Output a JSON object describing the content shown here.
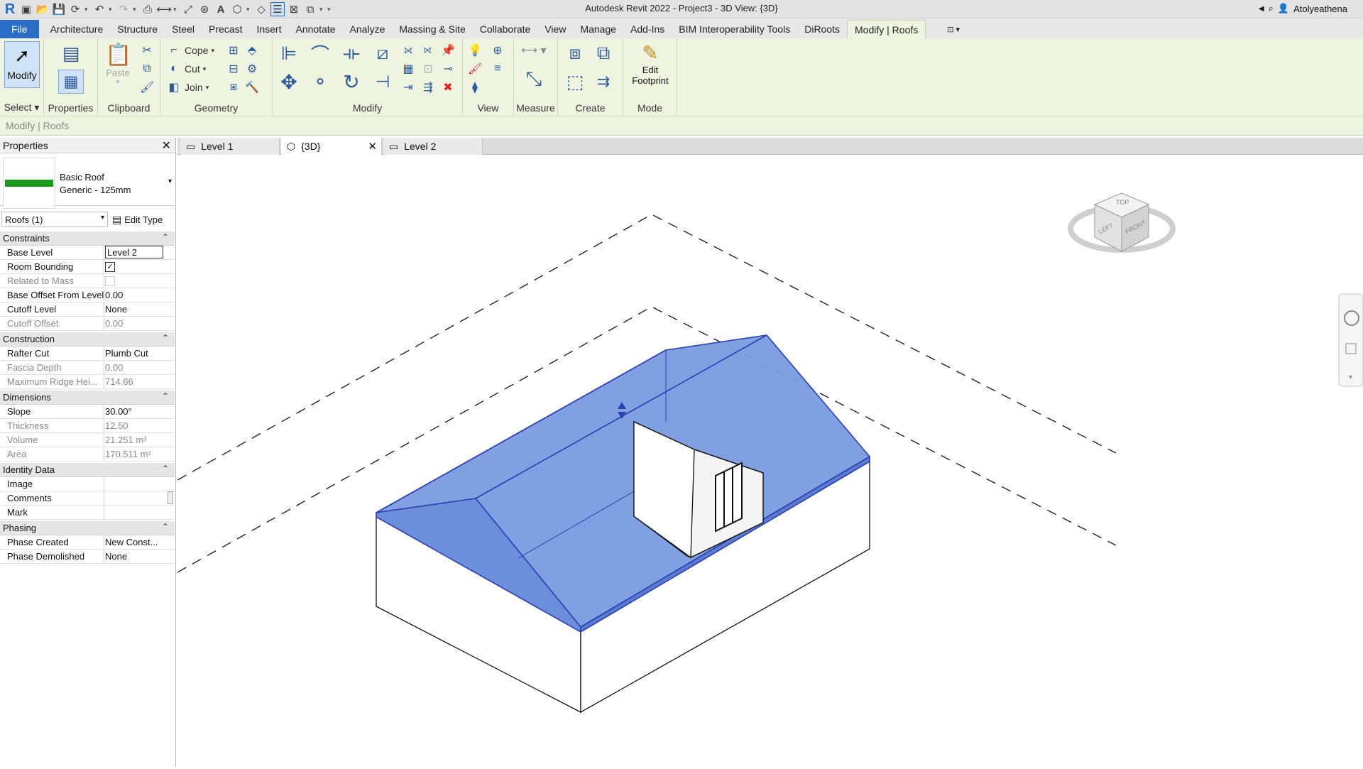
{
  "titlebar": {
    "title": "Autodesk Revit 2022 - Project3 - 3D View: {3D}",
    "user": "Atolyeathena"
  },
  "menu": {
    "tabs": [
      "File",
      "Architecture",
      "Structure",
      "Steel",
      "Precast",
      "Insert",
      "Annotate",
      "Analyze",
      "Massing & Site",
      "Collaborate",
      "View",
      "Manage",
      "Add-Ins",
      "BIM Interoperability Tools",
      "DiRoots",
      "Modify | Roofs"
    ],
    "active_tab": "Modify | Roofs"
  },
  "ribbon": {
    "modify_label": "Modify",
    "select_label": "Select",
    "properties_label": "Properties",
    "clipboard": {
      "paste": "Paste",
      "label": "Clipboard"
    },
    "geometry": {
      "cope": "Cope",
      "cut": "Cut",
      "join": "Join",
      "label": "Geometry"
    },
    "modify_panel_label": "Modify",
    "view_label": "View",
    "measure_label": "Measure",
    "create_label": "Create",
    "mode": {
      "edit_line1": "Edit",
      "edit_line2": "Footprint",
      "label": "Mode"
    }
  },
  "context_bar": {
    "text": "Modify | Roofs"
  },
  "properties": {
    "title": "Properties",
    "type_name": "Basic Roof",
    "type_sub": "Generic - 125mm",
    "filter": "Roofs (1)",
    "edit_type": "Edit Type",
    "groups": {
      "constraints": "Constraints",
      "construction": "Construction",
      "dimensions": "Dimensions",
      "identity": "Identity Data",
      "phasing": "Phasing"
    },
    "rows": {
      "base_level": {
        "k": "Base Level",
        "v": "Level 2"
      },
      "room_bounding": {
        "k": "Room Bounding",
        "checked": true
      },
      "related_mass": {
        "k": "Related to Mass"
      },
      "base_offset": {
        "k": "Base Offset From Level",
        "v": "0.00"
      },
      "cutoff_level": {
        "k": "Cutoff Level",
        "v": "None"
      },
      "cutoff_offset": {
        "k": "Cutoff Offset",
        "v": "0.00"
      },
      "rafter_cut": {
        "k": "Rafter Cut",
        "v": "Plumb Cut"
      },
      "fascia_depth": {
        "k": "Fascia Depth",
        "v": "0.00"
      },
      "max_ridge": {
        "k": "Maximum Ridge Hei...",
        "v": "714.66"
      },
      "slope": {
        "k": "Slope",
        "v": "30.00°"
      },
      "thickness": {
        "k": "Thickness",
        "v": "12.50"
      },
      "volume": {
        "k": "Volume",
        "v": "21.251 m³"
      },
      "area": {
        "k": "Area",
        "v": "170.511 m²"
      },
      "image": {
        "k": "Image",
        "v": ""
      },
      "comments": {
        "k": "Comments",
        "v": ""
      },
      "mark": {
        "k": "Mark",
        "v": ""
      },
      "phase_created": {
        "k": "Phase Created",
        "v": "New Const..."
      },
      "phase_demolished": {
        "k": "Phase Demolished",
        "v": "None"
      }
    }
  },
  "view_tabs": [
    "Level 1",
    "{3D}",
    "Level 2"
  ],
  "viewcube": {
    "top": "TOP",
    "left": "LEFT",
    "front": "FRONT"
  },
  "colors": {
    "accent": "#2b6cc4",
    "ribbon_bg": "#eef4e0",
    "roof_fill": "#7a9be0",
    "roof_stroke": "#2b3fb0"
  }
}
